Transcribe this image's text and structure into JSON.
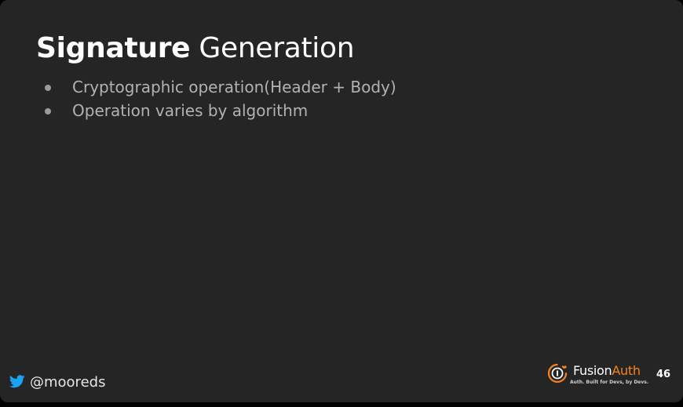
{
  "slide": {
    "title_bold": "Signature",
    "title_rest": " Generation",
    "bullets": [
      "Cryptographic operation(Header + Body)",
      "Operation varies by algorithm"
    ],
    "page_number": "46"
  },
  "footer": {
    "twitter_icon": "twitter-bird-icon",
    "twitter_handle": "@mooreds"
  },
  "brand": {
    "logo_icon": "fusionauth-logo-icon",
    "name_part1": "Fusion",
    "name_part2": "Auth",
    "tagline": "Auth. Built for Devs, by Devs."
  },
  "colors": {
    "slide_background": "#252525",
    "title": "#ffffff",
    "bullet_text": "#b2b2b2",
    "brand_accent": "#f58320",
    "twitter_blue": "#1da1f2"
  }
}
